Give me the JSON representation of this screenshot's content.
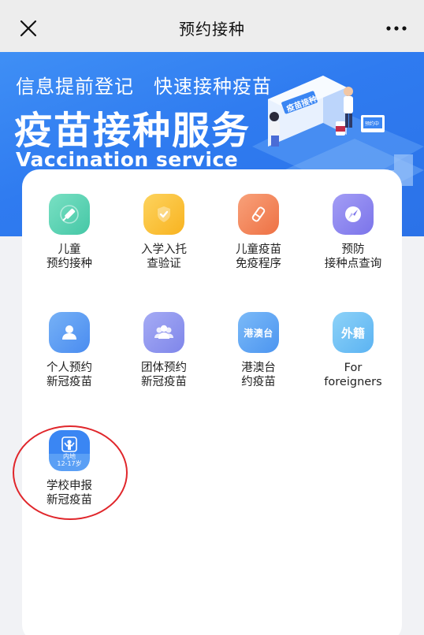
{
  "navbar": {
    "title": "预约接种"
  },
  "banner": {
    "slogan": "信息提前登记　快速接种疫苗",
    "title": "疫苗接种服务",
    "subtitle": "Vaccination  service",
    "sign_text": "疫苗接种",
    "monitor_text": "预约中"
  },
  "colors": {
    "brand_blue": "#3a86f3",
    "highlight_red": "#e0262b",
    "nav_bg": "#ededed"
  },
  "services": [
    {
      "id": "child-appointment",
      "icon": "syringe-icon",
      "color": "#5fd3b3",
      "line1": "儿童",
      "line2": "预约接种"
    },
    {
      "id": "school-check",
      "icon": "shield-check-icon",
      "color": "#fbc43f",
      "line1": "入学入托",
      "line2": "查验证"
    },
    {
      "id": "child-schedule",
      "icon": "vial-icon",
      "color": "#f38a5c",
      "line1": "儿童疫苗",
      "line2": "免疫程序"
    },
    {
      "id": "site-query",
      "icon": "compass-icon",
      "color": "#8c86f0",
      "line1": "预防",
      "line2": "接种点查询"
    },
    {
      "id": "personal-covid",
      "icon": "person-icon",
      "color": "#5a9cf2",
      "line1": "个人预约",
      "line2": "新冠疫苗"
    },
    {
      "id": "group-covid",
      "icon": "group-icon",
      "color": "#8f96ef",
      "line1": "团体预约",
      "line2": "新冠疫苗"
    },
    {
      "id": "hmt-vaccine",
      "icon": "hk-macau-taiwan-icon",
      "icon_text": "港澳台",
      "color": "#5aa6f5",
      "line1": "港澳台",
      "line2": "约疫苗"
    },
    {
      "id": "foreigners",
      "icon": "foreigner-icon",
      "icon_text": "外籍",
      "color": "#6cc0f5",
      "line1": "For",
      "line2": "foreigners"
    },
    {
      "id": "school-report-covid",
      "icon": "student-icon",
      "icon_text_line1": "内地",
      "icon_text_line2": "12-17岁",
      "color": "#3a86f3",
      "line1": "学校申报",
      "line2": "新冠疫苗"
    }
  ]
}
